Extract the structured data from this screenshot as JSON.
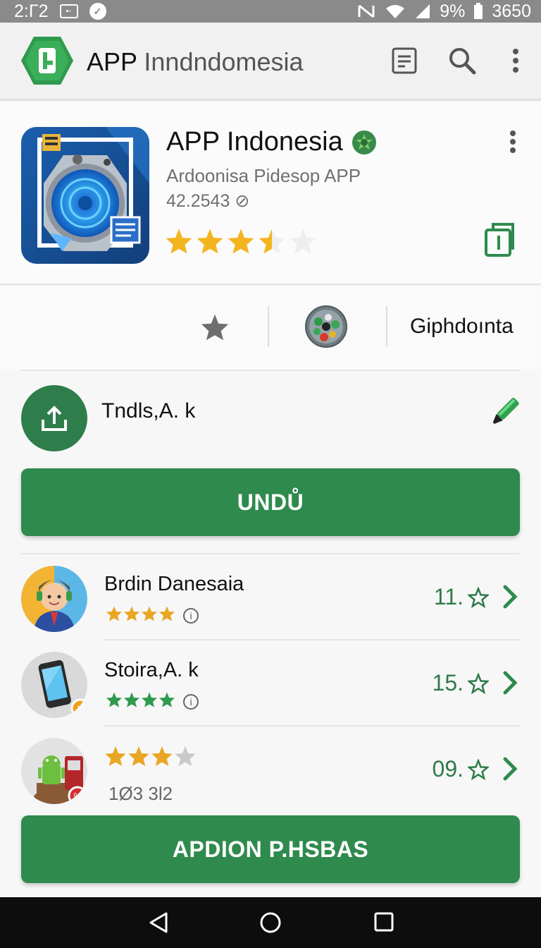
{
  "status_bar": {
    "time": "2:Γ2",
    "battery": "9%",
    "right_number": "3650",
    "icons": [
      "nfc-icon",
      "vpn-icon",
      "wifi-icon",
      "signal-icon",
      "battery-icon"
    ]
  },
  "app_bar": {
    "title_bold": "APP",
    "title_light": "Inndndomesia",
    "icons": [
      "document-icon",
      "search-icon",
      "more-vert-icon"
    ]
  },
  "app": {
    "name": "APP Indonesia",
    "developer": "Ardoonisa Pidesop APP",
    "version": "42.2543 ⊘",
    "rating": 3.5,
    "max_rating": 5,
    "colors": {
      "accent": "#2f8a4d",
      "star": "#f3b51f"
    }
  },
  "info_row": {
    "label": "Giphdoınta"
  },
  "upload_row": {
    "label": "Tndls,A. k"
  },
  "primary_button": {
    "label": "UNDŮ"
  },
  "list": [
    {
      "name": "Brdin Danesaia",
      "score": "11.",
      "stars": 4,
      "star_color": "#e9a623"
    },
    {
      "name": "Stoira,A. k",
      "score": "15.",
      "stars": 4,
      "star_color": "#2f9a4d"
    },
    {
      "name": "",
      "score": "09.",
      "stars": 3,
      "star_color": "#e9a623",
      "count": "1Ø3 3l2"
    }
  ],
  "secondary_button": {
    "label": "APDION P.HSBAS"
  },
  "nav_bar": {
    "icons": [
      "back-icon",
      "home-icon",
      "recents-icon"
    ]
  }
}
